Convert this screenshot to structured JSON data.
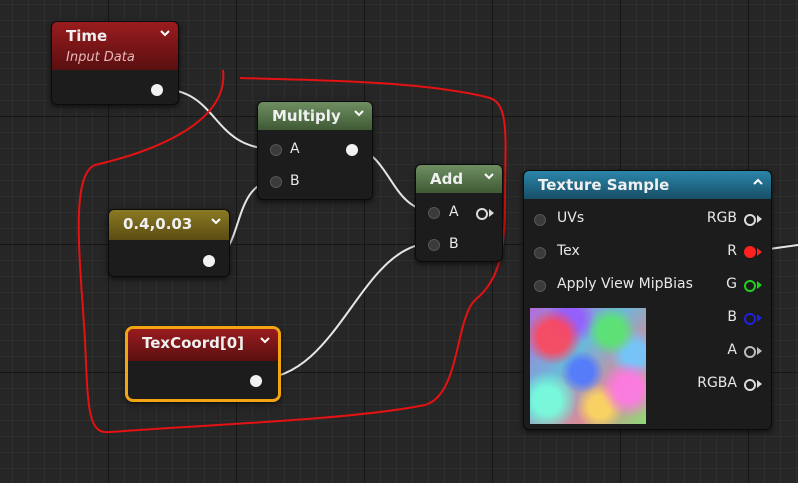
{
  "nodes": {
    "time": {
      "title": "Time",
      "subtitle": "Input Data"
    },
    "constant": {
      "title": "0.4,0.03"
    },
    "texcoord": {
      "title": "TexCoord[0]"
    },
    "multiply": {
      "title": "Multiply",
      "pin_a": "A",
      "pin_b": "B"
    },
    "add": {
      "title": "Add",
      "pin_a": "A",
      "pin_b": "B"
    },
    "texture_sample": {
      "title": "Texture Sample",
      "inputs": [
        "UVs",
        "Tex",
        "Apply View MipBias"
      ],
      "outputs": [
        "RGB",
        "R",
        "G",
        "B",
        "A",
        "RGBA"
      ]
    }
  },
  "colors": {
    "time_header": "#7a1416",
    "constant_header": "#7a6a1a",
    "texcoord_header": "#7a1416",
    "math_header": "#5a7a4e",
    "texture_header": "#1f6a8a",
    "annotation": "#e41212",
    "pin_r": "#ff2020",
    "pin_g": "#20d020",
    "pin_b": "#2020e0"
  }
}
